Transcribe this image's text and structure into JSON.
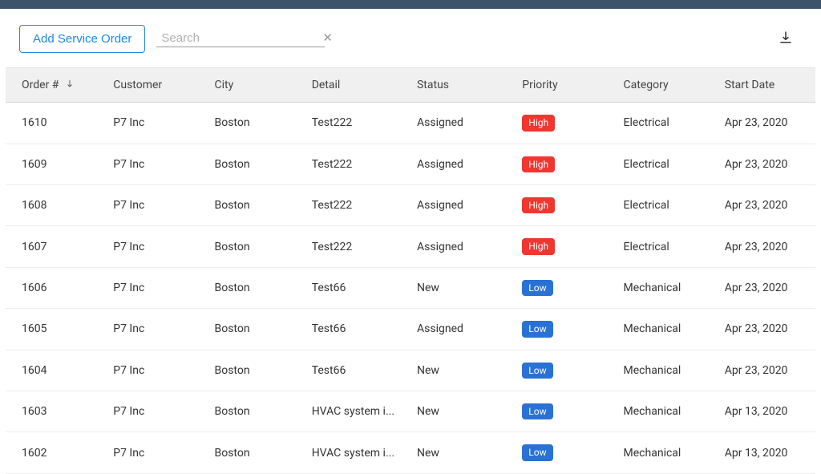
{
  "toolbar": {
    "add_label": "Add Service Order",
    "search_placeholder": "Search"
  },
  "columns": {
    "order": "Order #",
    "customer": "Customer",
    "city": "City",
    "detail": "Detail",
    "status": "Status",
    "priority": "Priority",
    "category": "Category",
    "start_date": "Start Date"
  },
  "rows": [
    {
      "order": "1610",
      "customer": "P7 Inc",
      "city": "Boston",
      "detail": "Test222",
      "status": "Assigned",
      "priority": "High",
      "priority_class": "high",
      "category": "Electrical",
      "start_date": "Apr 23, 2020"
    },
    {
      "order": "1609",
      "customer": "P7 Inc",
      "city": "Boston",
      "detail": "Test222",
      "status": "Assigned",
      "priority": "High",
      "priority_class": "high",
      "category": "Electrical",
      "start_date": "Apr 23, 2020"
    },
    {
      "order": "1608",
      "customer": "P7 Inc",
      "city": "Boston",
      "detail": "Test222",
      "status": "Assigned",
      "priority": "High",
      "priority_class": "high",
      "category": "Electrical",
      "start_date": "Apr 23, 2020"
    },
    {
      "order": "1607",
      "customer": "P7 Inc",
      "city": "Boston",
      "detail": "Test222",
      "status": "Assigned",
      "priority": "High",
      "priority_class": "high",
      "category": "Electrical",
      "start_date": "Apr 23, 2020"
    },
    {
      "order": "1606",
      "customer": "P7 Inc",
      "city": "Boston",
      "detail": "Test66",
      "status": "New",
      "priority": "Low",
      "priority_class": "low",
      "category": "Mechanical",
      "start_date": "Apr 23, 2020"
    },
    {
      "order": "1605",
      "customer": "P7 Inc",
      "city": "Boston",
      "detail": "Test66",
      "status": "Assigned",
      "priority": "Low",
      "priority_class": "low",
      "category": "Mechanical",
      "start_date": "Apr 23, 2020"
    },
    {
      "order": "1604",
      "customer": "P7 Inc",
      "city": "Boston",
      "detail": "Test66",
      "status": "New",
      "priority": "Low",
      "priority_class": "low",
      "category": "Mechanical",
      "start_date": "Apr 23, 2020"
    },
    {
      "order": "1603",
      "customer": "P7 Inc",
      "city": "Boston",
      "detail": "HVAC system i...",
      "status": "New",
      "priority": "Low",
      "priority_class": "low",
      "category": "Mechanical",
      "start_date": "Apr 13, 2020"
    },
    {
      "order": "1602",
      "customer": "P7 Inc",
      "city": "Boston",
      "detail": "HVAC system i...",
      "status": "New",
      "priority": "Low",
      "priority_class": "low",
      "category": "Mechanical",
      "start_date": "Apr 13, 2020"
    }
  ]
}
